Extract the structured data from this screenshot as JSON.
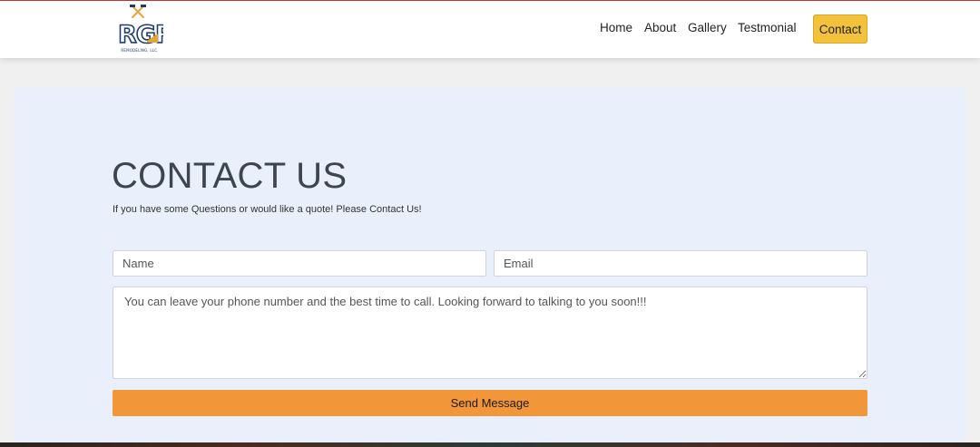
{
  "brand": {
    "logo_text": "RGR",
    "logo_subtext": "REMODELING, LLC."
  },
  "nav": {
    "items": [
      {
        "label": "Home"
      },
      {
        "label": "About"
      },
      {
        "label": "Gallery"
      },
      {
        "label": "Testmonial"
      }
    ],
    "cta_label": "Contact"
  },
  "contact": {
    "title": "CONTACT US",
    "subtitle": "If you have some Questions or would like a quote! Please Contact Us!",
    "name_placeholder": "Name",
    "email_placeholder": "Email",
    "message_placeholder": "You can leave your phone number and the best time to call. Looking forward to talking to you soon!!!",
    "submit_label": "Send Message"
  },
  "colors": {
    "accent_cta": "#f2c23c",
    "submit": "#f2963a",
    "section_bg": "#e9effb",
    "logo_blue": "#1f3d6b",
    "logo_orange": "#e8a23a"
  }
}
